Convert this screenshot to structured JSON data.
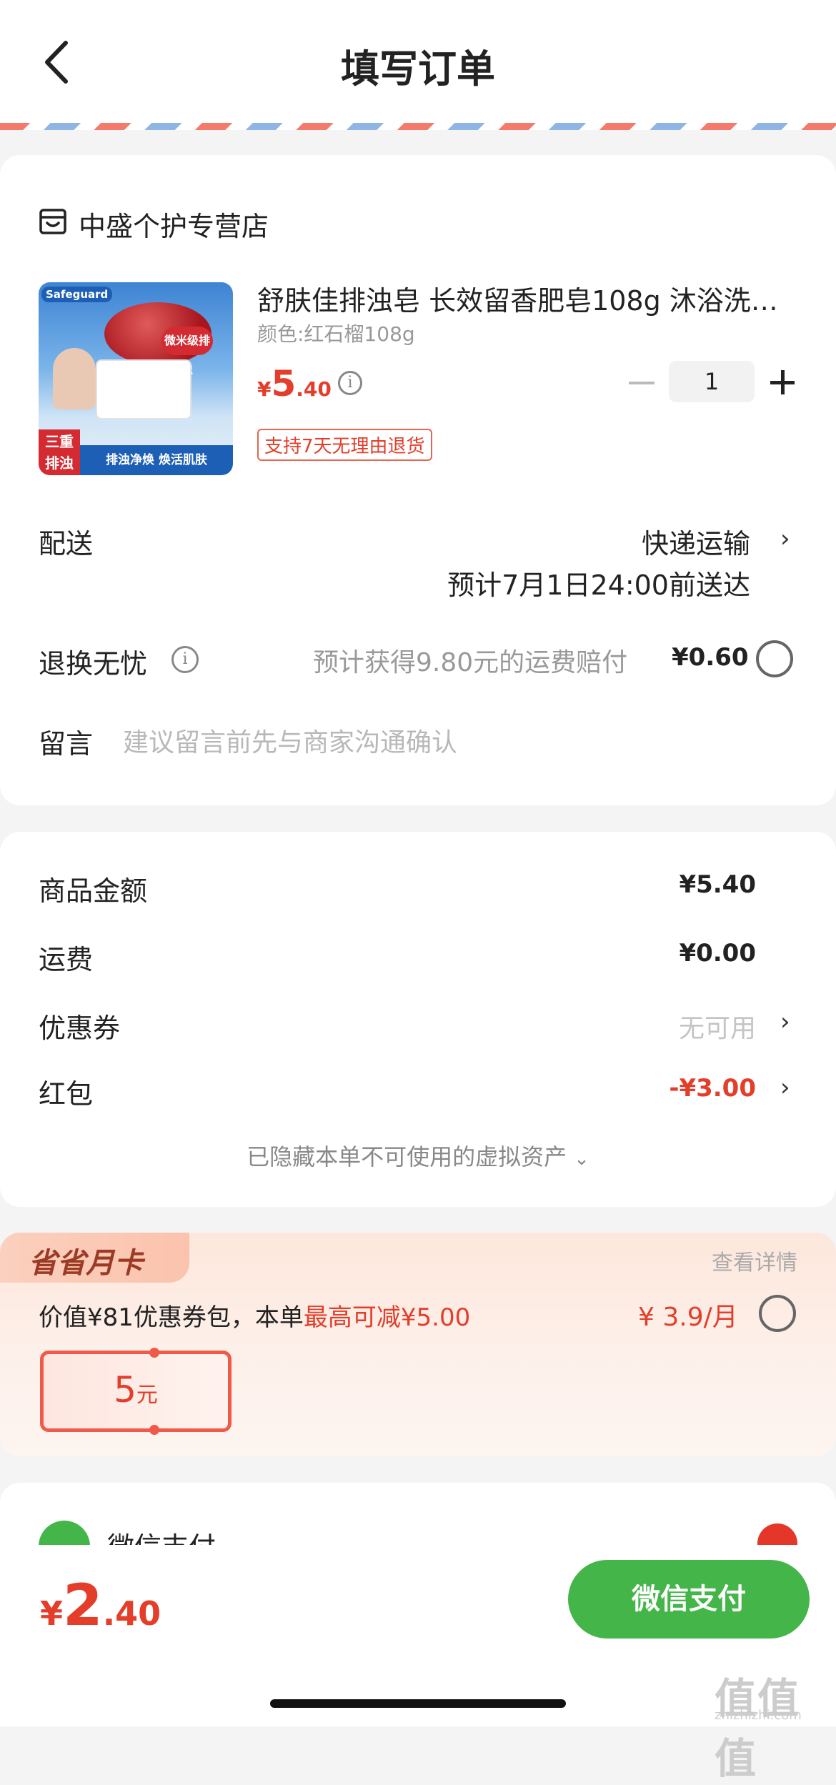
{
  "header": {
    "title": "填写订单"
  },
  "store": {
    "name": "中盛个护专营店"
  },
  "product": {
    "image_texts": {
      "brand": "Safeguard",
      "tag": "微米级排浊",
      "side": "三重排浊",
      "bottom": "排浊净焕 焕活肌肤"
    },
    "title": "舒肤佳排浊皂 长效留香肥皂108g 沐浴洗…",
    "spec": "颜色:红石榴108g",
    "price_symbol": "¥",
    "price_int": "5",
    "price_dec": ".40",
    "quantity": "1",
    "return_tag": "支持7天无理由退货"
  },
  "delivery": {
    "label": "配送",
    "method": "快递运输",
    "eta": "预计7月1日24:00前送达"
  },
  "insurance": {
    "label": "退换无忧",
    "hint": "预计获得9.80元的运费赔付",
    "price": "¥0.60"
  },
  "message": {
    "label": "留言",
    "placeholder": "建议留言前先与商家沟通确认"
  },
  "summary": {
    "rows": [
      {
        "label": "商品金额",
        "value": "¥5.40"
      },
      {
        "label": "运费",
        "value": "¥0.00"
      },
      {
        "label": "优惠券",
        "value": "无可用"
      },
      {
        "label": "红包",
        "value": "-¥3.00"
      }
    ],
    "hidden_note": "已隐藏本单不可使用的虚拟资产"
  },
  "monthcard": {
    "badge": "省省月卡",
    "details": "查看详情",
    "desc_prefix": "价值¥81优惠券包，本单",
    "desc_highlight": "最高可减¥5.00",
    "price": "¥ 3.9/月",
    "voucher_amount": "5",
    "voucher_unit": "元"
  },
  "payment": {
    "method": "微信支付"
  },
  "footer": {
    "total_symbol": "¥",
    "total_int": "2",
    "total_dec": ".40",
    "pay_button": "微信支付"
  },
  "watermark": {
    "text": "值值值",
    "url": "zhizhizhi.com"
  },
  "colors": {
    "accent_red": "#e43d2a",
    "wechat_green": "#44b549"
  }
}
